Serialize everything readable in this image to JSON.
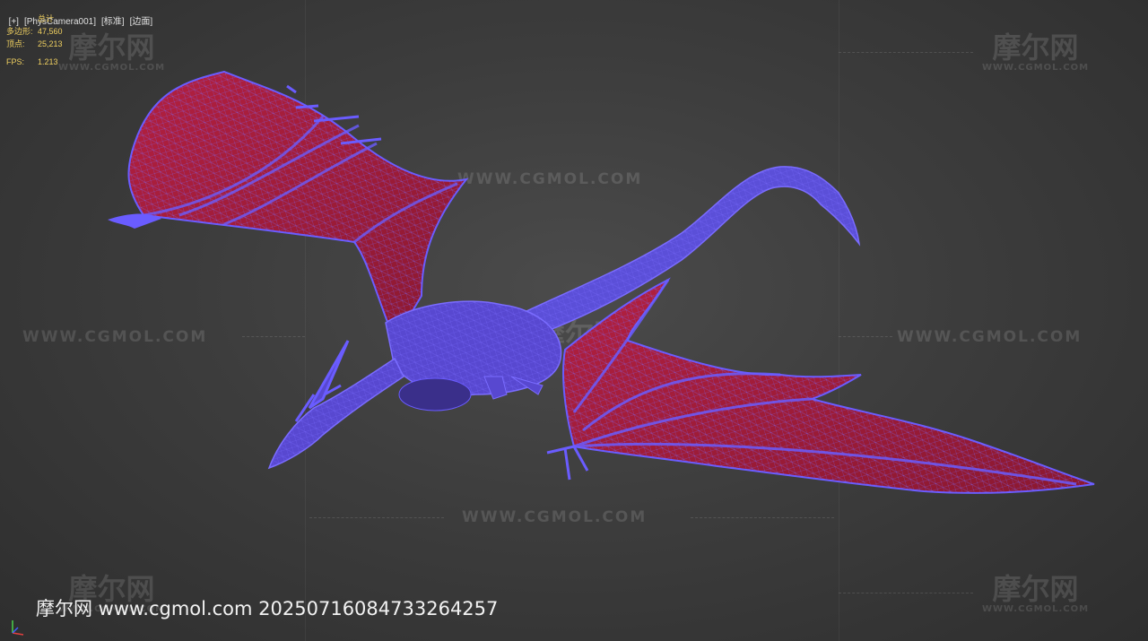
{
  "viewport": {
    "label_plus": "[+]",
    "label_camera": "[PhysCamera001]",
    "label_standard": "[标准]",
    "label_edges": "[边面]"
  },
  "stats": {
    "total_label": "总计",
    "poly_label": "多边形:",
    "poly_value": "47,560",
    "vert_label": "顶点:",
    "vert_value": "25,213",
    "fps_label": "FPS:",
    "fps_value": "1.213"
  },
  "watermark": {
    "site": "WWW.CGMOL.COM",
    "logo_cn": "摩尔网",
    "logo_en": "WWW.CGMOL.COM",
    "bottom_text": "摩尔网 www.cgmol.com 2025071608473326425​7"
  },
  "colors": {
    "wing_membrane": "#c0283c",
    "wire": "#6a5cff",
    "stats_text": "#f0d060"
  }
}
